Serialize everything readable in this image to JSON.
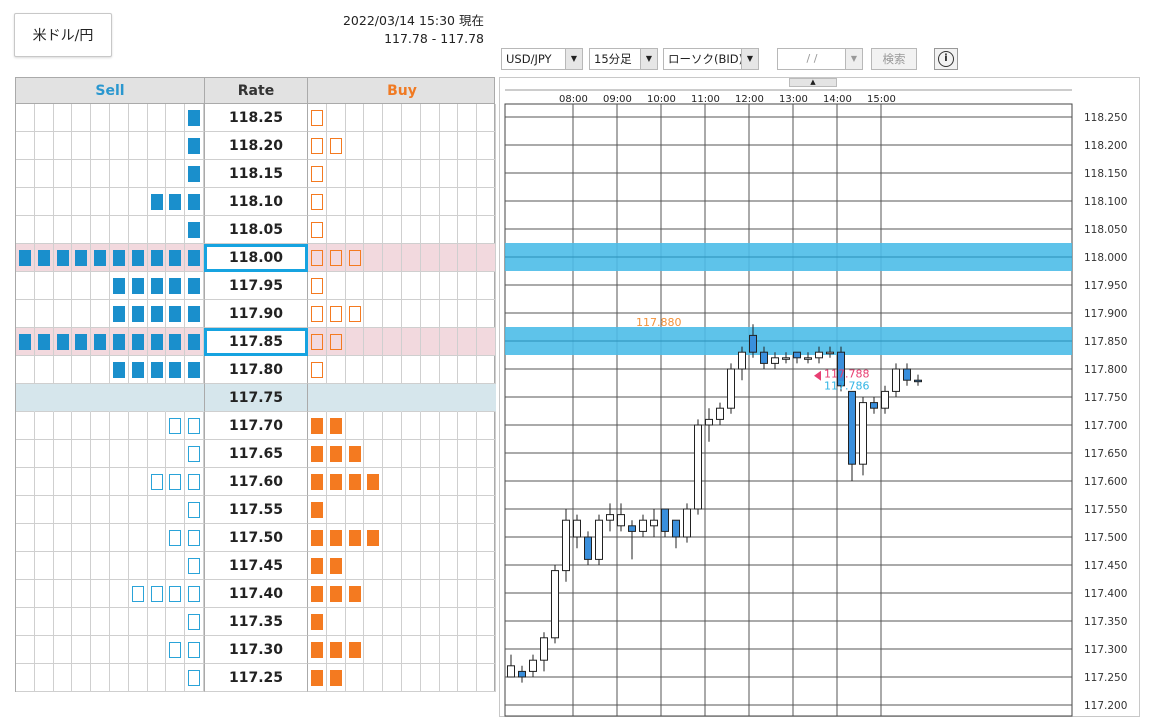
{
  "pair_button": "米ドル/円",
  "timestamp_line1": "2022/03/14 15:30 現在",
  "timestamp_line2": "117.78 - 117.78",
  "book": {
    "headers": {
      "sell": "Sell",
      "rate": "Rate",
      "buy": "Buy"
    },
    "rows": [
      {
        "rate": "118.25",
        "sell": 1,
        "sell_type": "filled",
        "buy": 1,
        "buy_type": "outline"
      },
      {
        "rate": "118.20",
        "sell": 1,
        "sell_type": "filled",
        "buy": 2,
        "buy_type": "outline"
      },
      {
        "rate": "118.15",
        "sell": 1,
        "sell_type": "filled",
        "buy": 1,
        "buy_type": "outline"
      },
      {
        "rate": "118.10",
        "sell": 3,
        "sell_type": "filled",
        "buy": 1,
        "buy_type": "outline"
      },
      {
        "rate": "118.05",
        "sell": 1,
        "sell_type": "filled",
        "buy": 1,
        "buy_type": "outline"
      },
      {
        "rate": "118.00",
        "sell": 10,
        "sell_type": "filled",
        "buy": 3,
        "buy_type": "outline",
        "highlight": true,
        "pink": true
      },
      {
        "rate": "117.95",
        "sell": 5,
        "sell_type": "filled",
        "buy": 1,
        "buy_type": "outline"
      },
      {
        "rate": "117.90",
        "sell": 5,
        "sell_type": "filled",
        "buy": 3,
        "buy_type": "outline"
      },
      {
        "rate": "117.85",
        "sell": 10,
        "sell_type": "filled",
        "buy": 2,
        "buy_type": "outline",
        "highlight": true,
        "pink": true
      },
      {
        "rate": "117.80",
        "sell": 5,
        "sell_type": "filled",
        "buy": 1,
        "buy_type": "outline"
      },
      {
        "rate": "117.75",
        "sell": 0,
        "sell_type": "filled",
        "buy": 0,
        "buy_type": "filled",
        "current": true
      },
      {
        "rate": "117.70",
        "sell": 2,
        "sell_type": "outline",
        "buy": 2,
        "buy_type": "filled"
      },
      {
        "rate": "117.65",
        "sell": 1,
        "sell_type": "outline",
        "buy": 3,
        "buy_type": "filled"
      },
      {
        "rate": "117.60",
        "sell": 3,
        "sell_type": "outline",
        "buy": 4,
        "buy_type": "filled"
      },
      {
        "rate": "117.55",
        "sell": 1,
        "sell_type": "outline",
        "buy": 1,
        "buy_type": "filled"
      },
      {
        "rate": "117.50",
        "sell": 2,
        "sell_type": "outline",
        "buy": 4,
        "buy_type": "filled"
      },
      {
        "rate": "117.45",
        "sell": 1,
        "sell_type": "outline",
        "buy": 2,
        "buy_type": "filled"
      },
      {
        "rate": "117.40",
        "sell": 4,
        "sell_type": "outline",
        "buy": 3,
        "buy_type": "filled"
      },
      {
        "rate": "117.35",
        "sell": 1,
        "sell_type": "outline",
        "buy": 1,
        "buy_type": "filled"
      },
      {
        "rate": "117.30",
        "sell": 2,
        "sell_type": "outline",
        "buy": 3,
        "buy_type": "filled"
      },
      {
        "rate": "117.25",
        "sell": 1,
        "sell_type": "outline",
        "buy": 2,
        "buy_type": "filled"
      }
    ]
  },
  "toolbar": {
    "symbol": "USD/JPY",
    "interval": "15分足",
    "chart_type": "ローソク(BID)",
    "date_placeholder": "/ /",
    "search_label": "検索",
    "info_icon": "info-icon"
  },
  "colors": {
    "sell": "#1a8fcc",
    "buy": "#f47a20",
    "zone": "#4dbde8",
    "bid_marker": "#e83e72",
    "ask_label": "#33b5e5",
    "high_label": "#f3923a"
  },
  "chart_data": {
    "type": "candlestick",
    "x_ticks": [
      "08:00",
      "09:00",
      "10:00",
      "11:00",
      "12:00",
      "13:00",
      "14:00",
      "15:00"
    ],
    "y_ticks": [
      "118.250",
      "118.200",
      "118.150",
      "118.100",
      "118.050",
      "118.000",
      "117.950",
      "117.900",
      "117.850",
      "117.800",
      "117.750",
      "117.700",
      "117.650",
      "117.600",
      "117.550",
      "117.500",
      "117.450",
      "117.400",
      "117.350",
      "117.300",
      "117.250",
      "117.200"
    ],
    "ylim": [
      117.2,
      118.25
    ],
    "zones": [
      118.0,
      117.85
    ],
    "high_label": "117.880",
    "bid_label": "117.788",
    "ask_label": "117.786",
    "candles": [
      {
        "t": "06:30",
        "o": 117.27,
        "h": 117.29,
        "l": 117.25,
        "c": 117.25,
        "dir": "up"
      },
      {
        "t": "06:45",
        "o": 117.25,
        "h": 117.27,
        "l": 117.24,
        "c": 117.26,
        "dir": "down"
      },
      {
        "t": "07:00",
        "o": 117.26,
        "h": 117.29,
        "l": 117.25,
        "c": 117.28,
        "dir": "up"
      },
      {
        "t": "07:15",
        "o": 117.28,
        "h": 117.33,
        "l": 117.26,
        "c": 117.32,
        "dir": "up"
      },
      {
        "t": "07:30",
        "o": 117.32,
        "h": 117.45,
        "l": 117.31,
        "c": 117.44,
        "dir": "up"
      },
      {
        "t": "07:45",
        "o": 117.44,
        "h": 117.55,
        "l": 117.42,
        "c": 117.53,
        "dir": "up"
      },
      {
        "t": "08:00",
        "o": 117.53,
        "h": 117.54,
        "l": 117.48,
        "c": 117.5,
        "dir": "up"
      },
      {
        "t": "08:15",
        "o": 117.5,
        "h": 117.51,
        "l": 117.45,
        "c": 117.46,
        "dir": "down"
      },
      {
        "t": "08:30",
        "o": 117.46,
        "h": 117.54,
        "l": 117.45,
        "c": 117.53,
        "dir": "up"
      },
      {
        "t": "08:45",
        "o": 117.53,
        "h": 117.56,
        "l": 117.51,
        "c": 117.54,
        "dir": "up"
      },
      {
        "t": "09:00",
        "o": 117.54,
        "h": 117.56,
        "l": 117.51,
        "c": 117.52,
        "dir": "up"
      },
      {
        "t": "09:15",
        "o": 117.52,
        "h": 117.53,
        "l": 117.46,
        "c": 117.51,
        "dir": "down"
      },
      {
        "t": "09:30",
        "o": 117.51,
        "h": 117.54,
        "l": 117.5,
        "c": 117.53,
        "dir": "up"
      },
      {
        "t": "09:45",
        "o": 117.53,
        "h": 117.55,
        "l": 117.5,
        "c": 117.52,
        "dir": "up"
      },
      {
        "t": "10:00",
        "o": 117.55,
        "h": 117.55,
        "l": 117.5,
        "c": 117.51,
        "dir": "down"
      },
      {
        "t": "10:15",
        "o": 117.53,
        "h": 117.53,
        "l": 117.48,
        "c": 117.5,
        "dir": "down"
      },
      {
        "t": "10:30",
        "o": 117.5,
        "h": 117.56,
        "l": 117.49,
        "c": 117.55,
        "dir": "up"
      },
      {
        "t": "10:45",
        "o": 117.55,
        "h": 117.71,
        "l": 117.54,
        "c": 117.7,
        "dir": "up"
      },
      {
        "t": "11:00",
        "o": 117.7,
        "h": 117.73,
        "l": 117.67,
        "c": 117.71,
        "dir": "up"
      },
      {
        "t": "11:15",
        "o": 117.71,
        "h": 117.74,
        "l": 117.7,
        "c": 117.73,
        "dir": "up"
      },
      {
        "t": "11:30",
        "o": 117.73,
        "h": 117.81,
        "l": 117.72,
        "c": 117.8,
        "dir": "up"
      },
      {
        "t": "11:45",
        "o": 117.8,
        "h": 117.84,
        "l": 117.78,
        "c": 117.83,
        "dir": "up"
      },
      {
        "t": "12:00",
        "o": 117.86,
        "h": 117.88,
        "l": 117.82,
        "c": 117.83,
        "dir": "down"
      },
      {
        "t": "12:15",
        "o": 117.83,
        "h": 117.84,
        "l": 117.8,
        "c": 117.81,
        "dir": "down"
      },
      {
        "t": "12:30",
        "o": 117.81,
        "h": 117.83,
        "l": 117.8,
        "c": 117.82,
        "dir": "up"
      },
      {
        "t": "12:45",
        "o": 117.82,
        "h": 117.83,
        "l": 117.81,
        "c": 117.82,
        "dir": "up"
      },
      {
        "t": "13:00",
        "o": 117.83,
        "h": 117.83,
        "l": 117.81,
        "c": 117.82,
        "dir": "down"
      },
      {
        "t": "13:15",
        "o": 117.82,
        "h": 117.83,
        "l": 117.81,
        "c": 117.82,
        "dir": "up"
      },
      {
        "t": "13:30",
        "o": 117.82,
        "h": 117.84,
        "l": 117.81,
        "c": 117.83,
        "dir": "up"
      },
      {
        "t": "13:45",
        "o": 117.83,
        "h": 117.84,
        "l": 117.82,
        "c": 117.83,
        "dir": "up"
      },
      {
        "t": "14:00",
        "o": 117.83,
        "h": 117.84,
        "l": 117.76,
        "c": 117.77,
        "dir": "down"
      },
      {
        "t": "14:15",
        "o": 117.76,
        "h": 117.76,
        "l": 117.6,
        "c": 117.63,
        "dir": "down"
      },
      {
        "t": "14:30",
        "o": 117.63,
        "h": 117.75,
        "l": 117.61,
        "c": 117.74,
        "dir": "up"
      },
      {
        "t": "14:45",
        "o": 117.74,
        "h": 117.75,
        "l": 117.72,
        "c": 117.73,
        "dir": "down"
      },
      {
        "t": "15:00",
        "o": 117.73,
        "h": 117.77,
        "l": 117.72,
        "c": 117.76,
        "dir": "up"
      },
      {
        "t": "15:15",
        "o": 117.76,
        "h": 117.81,
        "l": 117.75,
        "c": 117.8,
        "dir": "up"
      },
      {
        "t": "15:30",
        "o": 117.8,
        "h": 117.81,
        "l": 117.77,
        "c": 117.78,
        "dir": "down"
      },
      {
        "t": "15:45",
        "o": 117.78,
        "h": 117.79,
        "l": 117.77,
        "c": 117.78,
        "dir": "down"
      }
    ]
  }
}
